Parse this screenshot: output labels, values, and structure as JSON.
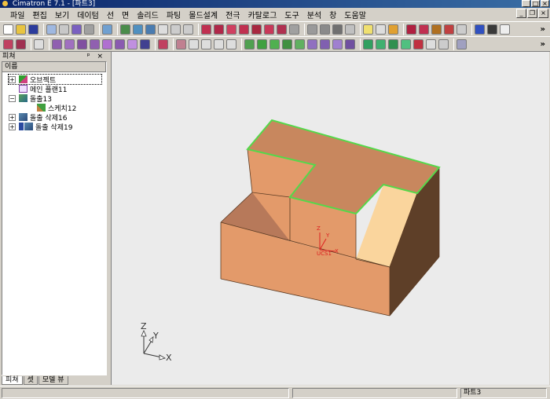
{
  "window": {
    "title": "Cimatron E 7.1 - [파트3]",
    "min": "_",
    "max": "□",
    "close": "×"
  },
  "menu": [
    "파일",
    "편집",
    "보기",
    "데이텀",
    "선",
    "면",
    "솔리드",
    "파팅",
    "몰드설계",
    "전극",
    "카탈로그",
    "도구",
    "분석",
    "창",
    "도움말"
  ],
  "mdi_controls": {
    "min": "_",
    "restore": "❐",
    "close": "×"
  },
  "toolbar_overflow": "»",
  "feature_panel": {
    "title": "피쳐",
    "controls": "ᵖ ×",
    "column_header": "이름",
    "tree": [
      {
        "label": "오브젝트",
        "icon": "object-icon",
        "expander": "+"
      },
      {
        "label": "메인 플랜11",
        "icon": "plane-icon",
        "expander": ""
      },
      {
        "label": "돌출13",
        "icon": "extrude-icon",
        "expander": "−"
      },
      {
        "label": "스케치12",
        "icon": "sketch-icon",
        "expander": ""
      },
      {
        "label": "돌출 삭제16",
        "icon": "extrude-cut-icon",
        "expander": "+"
      },
      {
        "label": "돌출 삭제19",
        "icon": "extrude-cut-icon",
        "expander": "+"
      }
    ],
    "tabs": [
      "피쳐",
      "셋",
      "모델 뷰"
    ]
  },
  "viewport": {
    "ucs_label": "UCS1",
    "ucs_axes": {
      "z": "Z",
      "y": "Y",
      "x": "X"
    },
    "triad_axes": {
      "z": "Z",
      "y": "Y",
      "x": "X"
    },
    "colors": {
      "background": "#ebebeb",
      "front_face": "#e39a6a",
      "top_face": "#c8875e",
      "dark_side": "#5e3f28",
      "light_face": "#fad59d",
      "edge_highlight": "#55d84a",
      "ucs": "#dd2020"
    }
  },
  "status": {
    "part_name": "파트3"
  }
}
